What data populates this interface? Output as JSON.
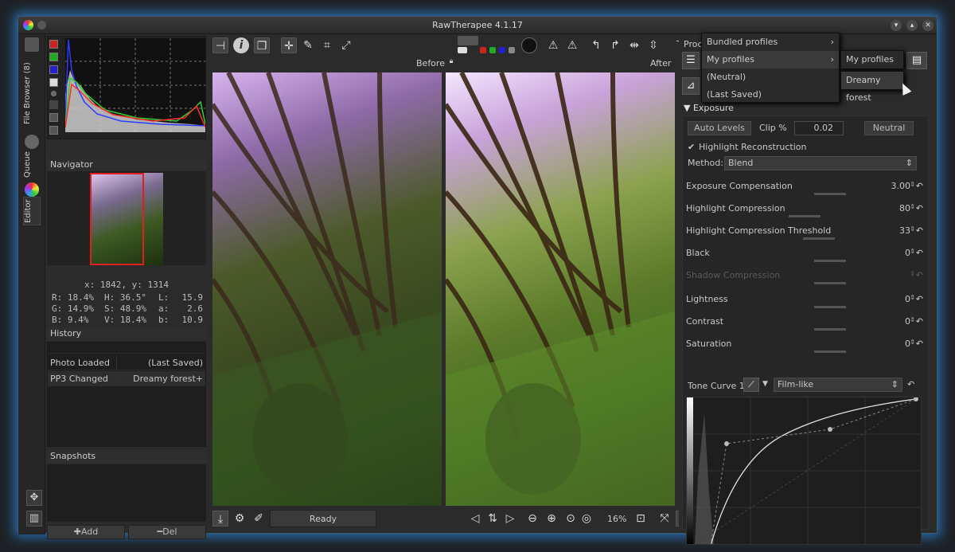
{
  "window": {
    "title": "RawTherapee 4.1.17"
  },
  "vtabs": {
    "file_browser": "File Browser (8)",
    "queue": "Queue",
    "editor": "Editor"
  },
  "navigator": {
    "title": "Navigator",
    "coords": "x: 1842, y: 1314",
    "info": {
      "r": "R: 18.4%",
      "g": "G: 14.9%",
      "b": "B:  9.4%",
      "h": "H: 36.5°",
      "s": "S: 48.9%",
      "v": "V: 18.4%",
      "l_lbl": "L:",
      "l_val": "15.9",
      "a_lbl": "a:",
      "a_val": "2.6",
      "bb_lbl": "b:",
      "bb_val": "10.9"
    }
  },
  "history": {
    "title": "History",
    "rows": [
      {
        "action": "Photo Loaded",
        "value": "(Last Saved)"
      },
      {
        "action": "PP3 Changed",
        "value": "Dreamy forest+"
      }
    ]
  },
  "snapshots": {
    "title": "Snapshots",
    "add_label": "Add",
    "del_label": "Del"
  },
  "preview": {
    "before_label": "Before",
    "after_label": "After"
  },
  "status": {
    "ready": "Ready",
    "zoom": "16%"
  },
  "right": {
    "proc_label": "Proce",
    "profiles_menu": [
      {
        "label": "Bundled profiles",
        "has_sub": true
      },
      {
        "label": "My profiles",
        "has_sub": true
      },
      {
        "label": "(Neutral)",
        "has_sub": false
      },
      {
        "label": "(Last Saved)",
        "has_sub": false
      }
    ],
    "submenu_header": "My profiles",
    "submenu_items": [
      "Dreamy forest"
    ],
    "exposure": {
      "title": "Exposure",
      "auto_levels": "Auto Levels",
      "clip_label": "Clip %",
      "clip_value": "0.02",
      "neutral": "Neutral",
      "highlight_recon": "Highlight Reconstruction",
      "method_label": "Method:",
      "method_value": "Blend",
      "sliders": [
        {
          "label": "Exposure Compensation",
          "value": "3.00",
          "position": 0.5
        },
        {
          "label": "Highlight Compression",
          "value": "80",
          "position": 0.1
        },
        {
          "label": "Highlight Compression Threshold",
          "value": "33",
          "position": 0.33
        },
        {
          "label": "Black",
          "value": "0",
          "position": 0.5
        },
        {
          "label": "Shadow Compression",
          "value": "",
          "position": 0.5,
          "disabled": true
        },
        {
          "label": "Lightness",
          "value": "0",
          "position": 0.5
        },
        {
          "label": "Contrast",
          "value": "0",
          "position": 0.5
        },
        {
          "label": "Saturation",
          "value": "0",
          "position": 0.5
        }
      ],
      "tone_curve_label": "Tone Curve 1:",
      "tone_curve_mode": "Film-like"
    }
  },
  "colors": {
    "accent_glow": "#2a6fb0",
    "nav_rect": "#e02020"
  }
}
